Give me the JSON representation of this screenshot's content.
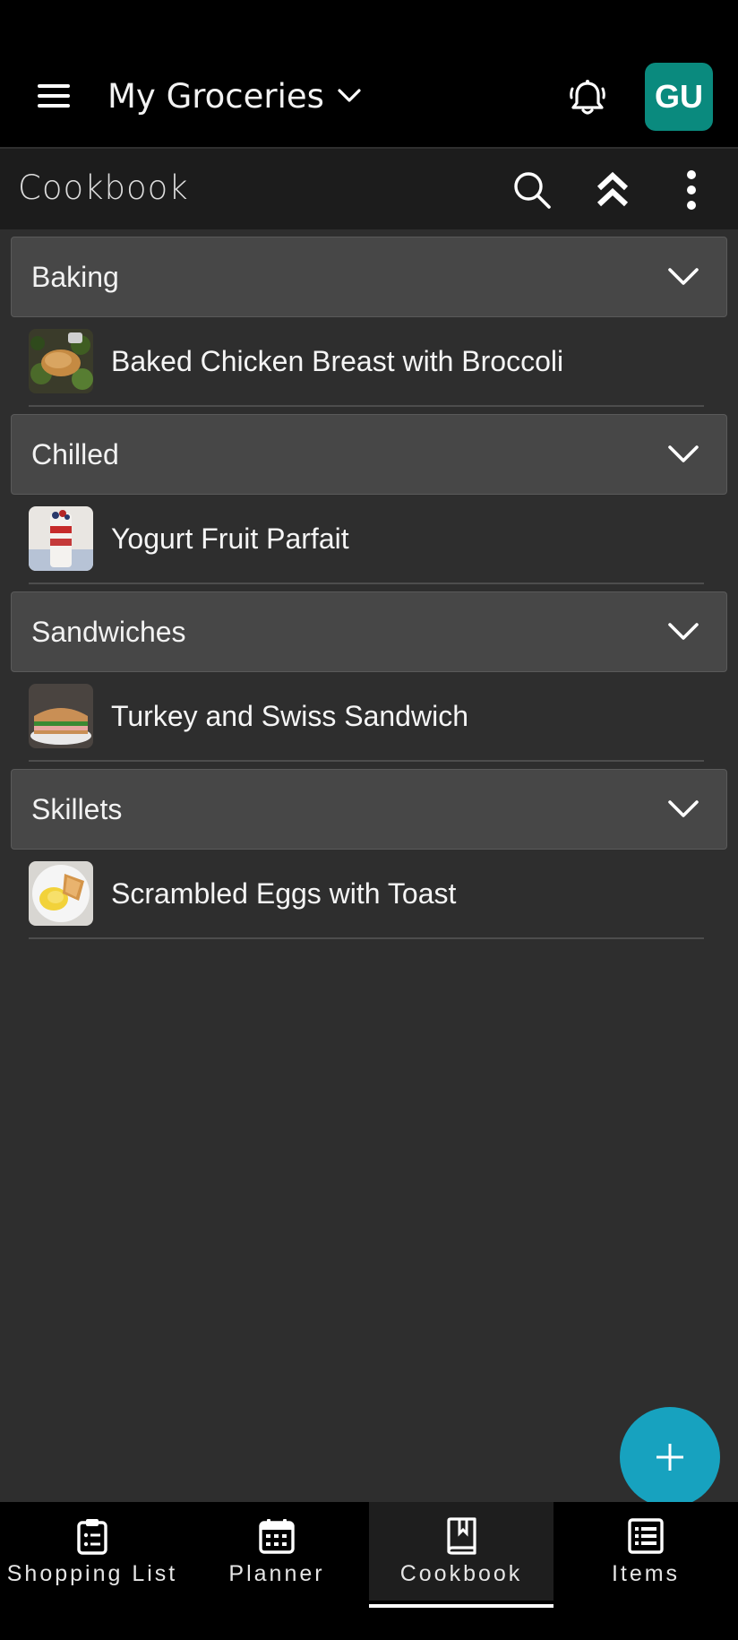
{
  "app_bar": {
    "list_name": "My Groceries",
    "avatar_initials": "GU",
    "avatar_color": "#0a8a7e"
  },
  "section": {
    "title": "Cookbook"
  },
  "categories": [
    {
      "name": "Baking",
      "recipes": [
        {
          "name": "Baked Chicken Breast with Broccoli",
          "thumb": "chicken-broccoli"
        }
      ]
    },
    {
      "name": "Chilled",
      "recipes": [
        {
          "name": "Yogurt Fruit Parfait",
          "thumb": "parfait"
        }
      ]
    },
    {
      "name": "Sandwiches",
      "recipes": [
        {
          "name": "Turkey and Swiss Sandwich",
          "thumb": "sandwich"
        }
      ]
    },
    {
      "name": "Skillets",
      "recipes": [
        {
          "name": "Scrambled Eggs with Toast",
          "thumb": "eggs-toast"
        }
      ]
    }
  ],
  "fab_color": "#17a2bf",
  "bottom_nav": [
    {
      "label": "Shopping List",
      "icon": "clipboard-icon"
    },
    {
      "label": "Planner",
      "icon": "calendar-icon"
    },
    {
      "label": "Cookbook",
      "icon": "book-icon",
      "active": true
    },
    {
      "label": "Items",
      "icon": "list-icon"
    }
  ]
}
